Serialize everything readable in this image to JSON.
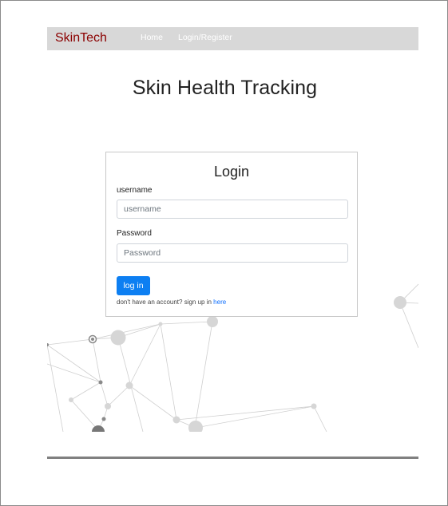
{
  "navbar": {
    "brand": "SkinTech",
    "links": [
      {
        "label": "Home"
      },
      {
        "label": "Login/Register"
      }
    ]
  },
  "page": {
    "title": "Skin Health Tracking"
  },
  "login": {
    "title": "Login",
    "username_label": "username",
    "username_placeholder": "username",
    "username_value": "",
    "password_label": "Password",
    "password_placeholder": "Password",
    "password_value": "",
    "submit_label": "log in",
    "signup_prefix": "don't have an account? sign up in ",
    "signup_link": "here"
  },
  "colors": {
    "brand": "#8b0000",
    "navbar_bg": "#d8d8d8",
    "primary_button": "#0d7ff2",
    "link": "#0d6efd"
  }
}
